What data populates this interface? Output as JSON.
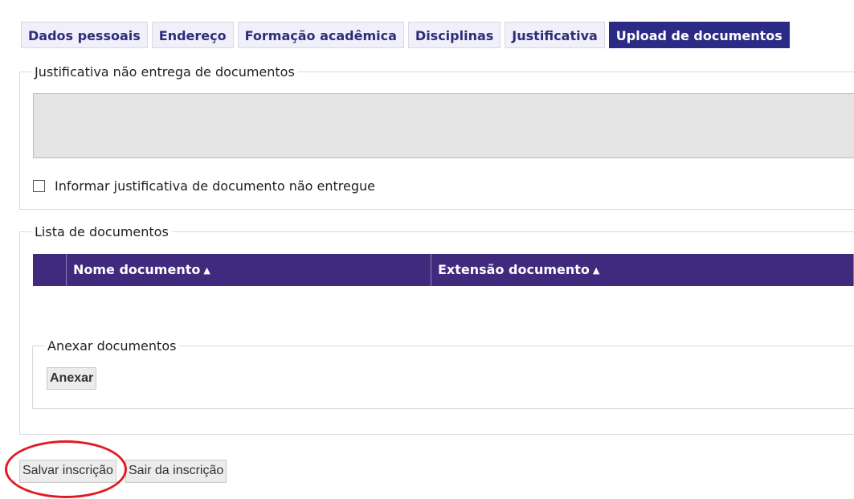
{
  "tabs": [
    {
      "label": "Dados pessoais"
    },
    {
      "label": "Endereço"
    },
    {
      "label": "Formação acadêmica"
    },
    {
      "label": "Disciplinas"
    },
    {
      "label": "Justificativa"
    },
    {
      "label": "Upload de documentos"
    }
  ],
  "active_tab": "Upload de documentos",
  "justificativa": {
    "legend": "Justificativa não entrega de documentos",
    "textarea_value": "",
    "checkbox_label": "Informar justificativa de documento não entregue",
    "checkbox_checked": false
  },
  "lista": {
    "legend": "Lista de documentos",
    "columns": [
      "Nome documento",
      "Extensão documento"
    ],
    "sort_icon": "sort-icon",
    "rows": []
  },
  "anexar": {
    "legend": "Anexar documentos",
    "button_label": "Anexar"
  },
  "footer": {
    "save_label": "Salvar inscrição",
    "exit_label": "Sair da inscrição"
  },
  "colors": {
    "tab_active_bg": "#2b2a84",
    "tab_bg": "#f0effa",
    "table_header_bg": "#3f2a7e",
    "highlight_circle": "#e01b24"
  }
}
